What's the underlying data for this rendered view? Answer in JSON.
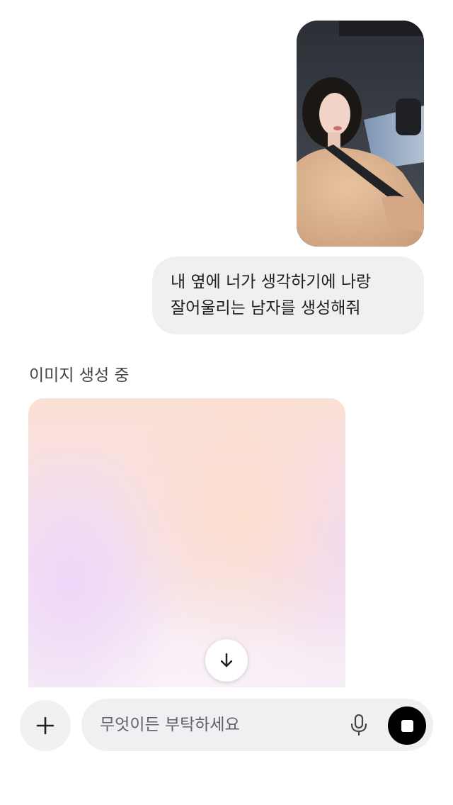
{
  "conversation": {
    "user_message": {
      "line1": "내 옆에 너가 생각하기에 나랑",
      "line2": "잘어울리는 남자를 생성해줘"
    },
    "assistant": {
      "status": "이미지 생성 중"
    }
  },
  "composer": {
    "placeholder": "무엇이든 부탁하세요"
  },
  "icons": {
    "add": "plus-icon",
    "mic": "microphone-icon",
    "stop": "stop-icon",
    "scroll_down": "arrow-down-icon"
  },
  "colors": {
    "user_bubble": "#f0f0f2",
    "stop_button": "#000000",
    "placeholder_gradient_top": "#fbe0d6",
    "placeholder_gradient_side": "#ecd6fa"
  }
}
